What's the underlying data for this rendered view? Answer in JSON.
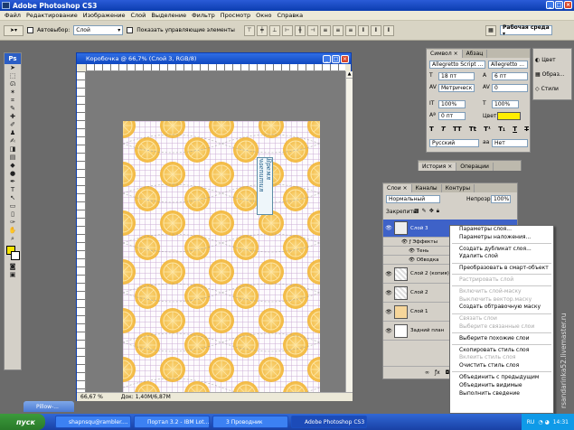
{
  "app": {
    "title": "Adobe Photoshop CS3"
  },
  "menu": [
    "Файл",
    "Редактирование",
    "Изображение",
    "Слой",
    "Выделение",
    "Фильтр",
    "Просмотр",
    "Окно",
    "Справка"
  ],
  "options": {
    "autoselect": "Автовыбор:",
    "autoselect_value": "Слой",
    "show_controls": "Показать управляющие элементы",
    "workspace": "Рабочая среда ▾"
  },
  "doc": {
    "title": "Коробочка @ 66,7% (Слой 3, RGB/8)",
    "zoom": "66,67 %",
    "docsize": "Док: 1,40M/6,87M",
    "sign": "Время чаепития"
  },
  "char_panel": {
    "tab1": "Символ",
    "tab2": "Абзац",
    "font": "Allegretto Script ...",
    "style": "Allegretto ...",
    "size": "18 пт",
    "leading": "6 пт",
    "kerning": "Метрическ",
    "tracking": "0",
    "vscale": "100%",
    "hscale": "100%",
    "baseline": "0 пт",
    "color_label": "Цвет:",
    "color": "#ffee00",
    "styles": [
      "T",
      "T",
      "TT",
      "Tt",
      "T¹",
      "T₁",
      "T",
      "T"
    ],
    "lang": "Русский",
    "aa": "Нет"
  },
  "side_panel": {
    "items": [
      "Цвет",
      "Образ...",
      "Стили"
    ]
  },
  "history_panel": {
    "tab1": "История",
    "tab2": "Операции"
  },
  "layers_panel": {
    "tabs": [
      "Слои",
      "Каналы",
      "Контуры"
    ],
    "blend": "Нормальный",
    "opacity_label": "Непрозр.:",
    "opacity": "100%",
    "lock_label": "Закрепить:",
    "layers": [
      {
        "name": "Слой 3",
        "selected": true
      },
      {
        "name": "Эффекты",
        "sub": true
      },
      {
        "name": "Тень",
        "sub2": true
      },
      {
        "name": "Обводка",
        "sub2": true
      },
      {
        "name": "Слой 2 (копия)"
      },
      {
        "name": "Слой 2"
      },
      {
        "name": "Слой 1"
      },
      {
        "name": "Задний план"
      }
    ]
  },
  "context_menu": [
    {
      "label": "Параметры слоя..."
    },
    {
      "label": "Параметры наложения..."
    },
    {
      "sep": true
    },
    {
      "label": "Создать дубликат слоя..."
    },
    {
      "label": "Удалить слой"
    },
    {
      "sep": true
    },
    {
      "label": "Преобразовать в смарт-объект"
    },
    {
      "sep": true
    },
    {
      "label": "Растрировать слой",
      "disabled": true
    },
    {
      "sep": true
    },
    {
      "label": "Включить слой-маску",
      "disabled": true
    },
    {
      "label": "Выключить вектор.маску",
      "disabled": true
    },
    {
      "label": "Создать обтравочную маску"
    },
    {
      "sep": true
    },
    {
      "label": "Связать слои",
      "disabled": true
    },
    {
      "label": "Выберите связанные слои",
      "disabled": true
    },
    {
      "sep": true
    },
    {
      "label": "Выберите похожие слои"
    },
    {
      "sep": true
    },
    {
      "label": "Скопировать стиль слоя"
    },
    {
      "label": "Вклеить стиль слоя",
      "disabled": true
    },
    {
      "label": "Очистить стиль слоя"
    },
    {
      "sep": true
    },
    {
      "label": "Объединить с предыдущим"
    },
    {
      "label": "Объединить видимые"
    },
    {
      "label": "Выполнить сведение"
    }
  ],
  "pillow_tab": "Pillow-...",
  "watermark": "rsandarinka52.livemaster.ru",
  "taskbar": {
    "start": "пуск",
    "tasks": [
      "shapnsqu@rambler....",
      "Портал 3.2 - IBM Lot...",
      "3 Проводник",
      "Adobe Photoshop CS3"
    ],
    "lang": "RU",
    "clock": "14:31"
  }
}
